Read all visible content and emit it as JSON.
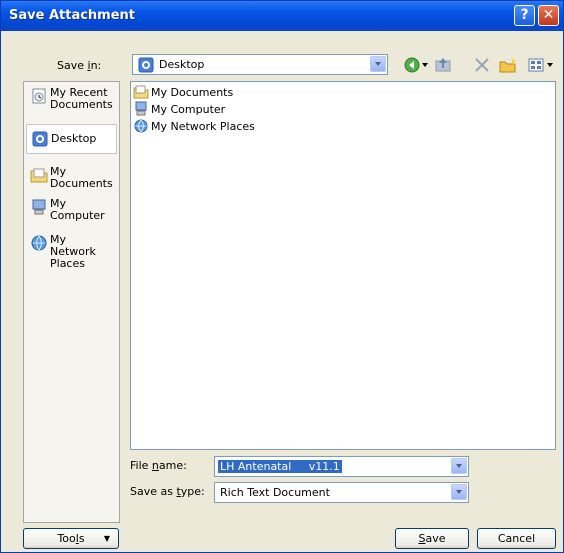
{
  "window": {
    "title": "Save Attachment"
  },
  "save_in": {
    "label_pre": "Save ",
    "label_key": "i",
    "label_post": "n:",
    "value": "Desktop"
  },
  "places": [
    {
      "label": "My Recent Documents",
      "icon": "recent-documents-icon"
    },
    {
      "label": "Desktop",
      "icon": "desktop-icon",
      "selected": true
    },
    {
      "label": "My Documents",
      "icon": "my-documents-icon"
    },
    {
      "label": "My Computer",
      "icon": "my-computer-icon"
    },
    {
      "label": "My Network Places",
      "icon": "network-places-icon"
    }
  ],
  "files": [
    {
      "name": "My Documents",
      "icon": "folder-icon"
    },
    {
      "name": "My Computer",
      "icon": "computer-icon"
    },
    {
      "name": "My Network Places",
      "icon": "network-icon"
    }
  ],
  "file_name": {
    "label_pre": "File ",
    "label_key": "n",
    "label_post": "ame:",
    "value": "LH Antenatal     v11.1"
  },
  "save_type": {
    "label_pre": "Save as ",
    "label_key": "t",
    "label_post": "ype:",
    "value": "Rich Text Document"
  },
  "buttons": {
    "tools_pre": "Too",
    "tools_key": "l",
    "tools_post": "s",
    "save_key": "S",
    "save_post": "ave",
    "cancel": "Cancel"
  },
  "colors": {
    "title_bar": "#0a59e8",
    "dialog_bg": "#ece9d8",
    "selection": "#316ac5"
  }
}
